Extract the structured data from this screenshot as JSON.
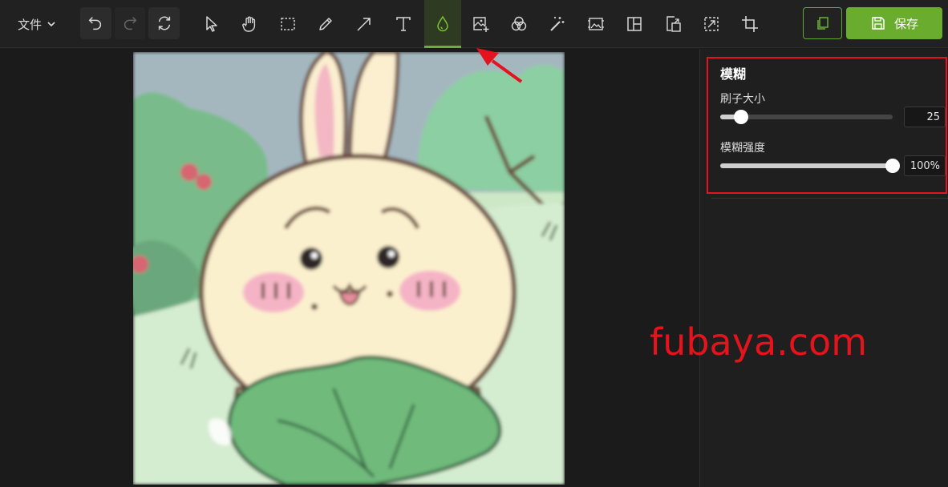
{
  "menu": {
    "file_label": "文件"
  },
  "toolbar": {
    "history": [
      "undo-icon",
      "redo-icon",
      "reset-icon"
    ],
    "tools": [
      "select-icon",
      "hand-icon",
      "marquee-icon",
      "pencil-icon",
      "arrow-icon",
      "text-icon",
      "blur-drop-icon",
      "image-add-icon",
      "filter-icon",
      "magic-wand-icon",
      "frame-image-icon",
      "layout-icon",
      "export-icon",
      "transform-icon",
      "crop-icon"
    ],
    "active_tool": "blur-drop-icon",
    "copy_icon": "copy-icon",
    "save_label": "保存"
  },
  "panel": {
    "title": "模糊",
    "brush_size": {
      "label": "刷子大小",
      "value": "25",
      "level": 0.12
    },
    "blur_strength": {
      "label": "模糊强度",
      "value": "100%",
      "level": 1.0
    }
  },
  "watermark": "fubaya.com",
  "colors": {
    "accent": "#6aac2e",
    "annotation_red": "#e3141f",
    "background": "#1c1c1c"
  }
}
